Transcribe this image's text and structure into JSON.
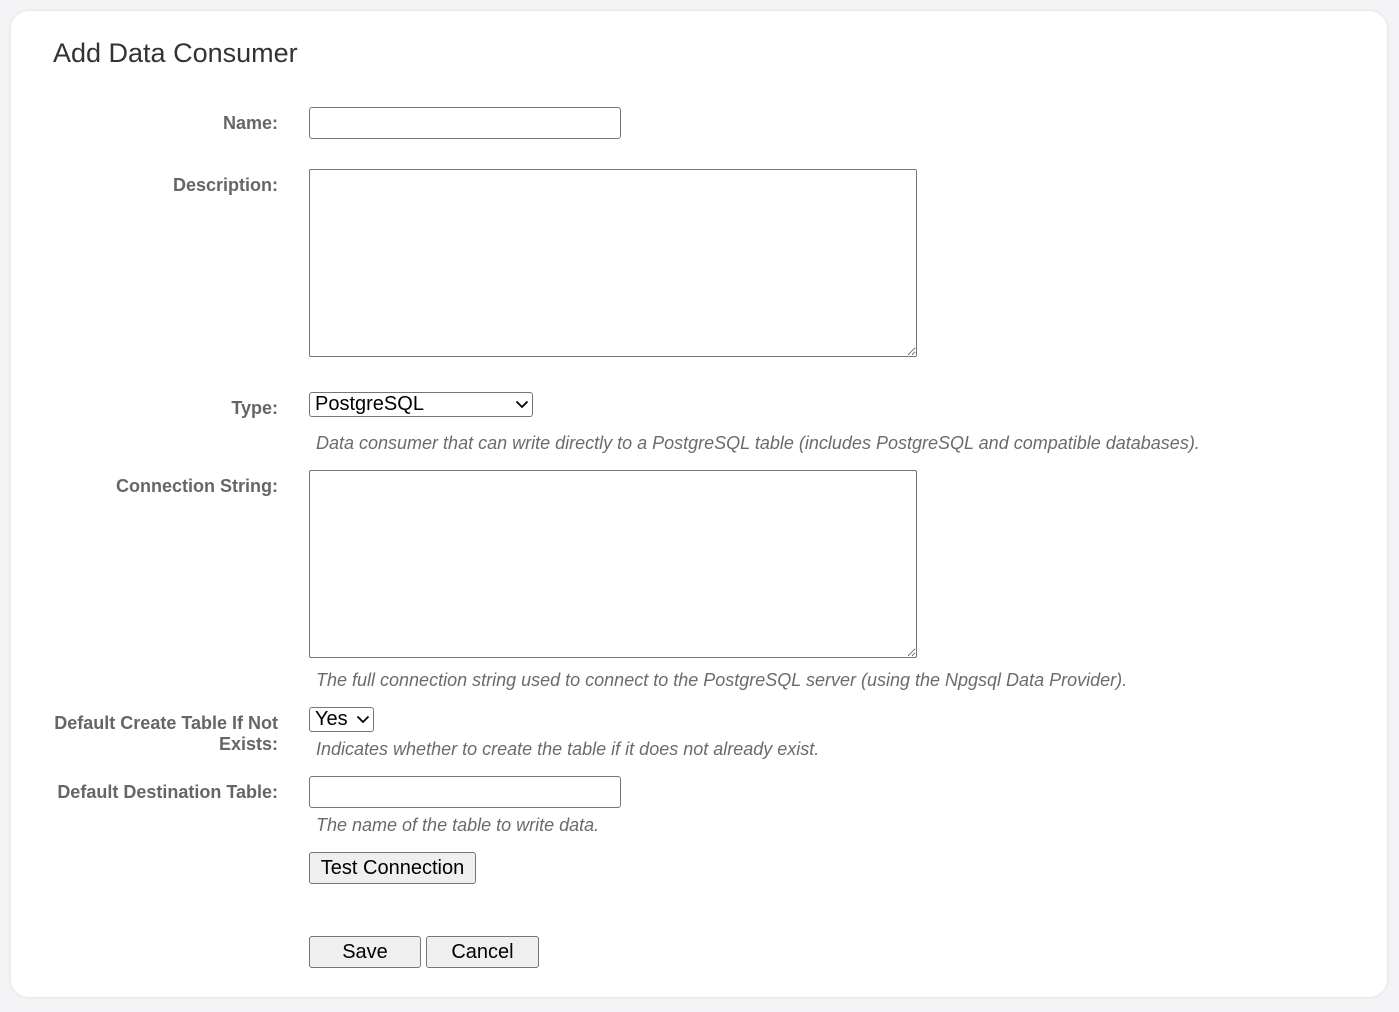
{
  "page": {
    "title": "Add Data Consumer"
  },
  "form": {
    "name": {
      "label": "Name:",
      "value": ""
    },
    "description": {
      "label": "Description:",
      "value": ""
    },
    "type": {
      "label": "Type:",
      "selected": "PostgreSQL",
      "help": "Data consumer that can write directly to a PostgreSQL table (includes PostgreSQL and compatible databases)."
    },
    "connection_string": {
      "label": "Connection String:",
      "value": "",
      "help": "The full connection string used to connect to the PostgreSQL server (using the Npgsql Data Provider)."
    },
    "create_table": {
      "label_line1": "Default Create Table If Not",
      "label_line2": "Exists:",
      "selected": "Yes",
      "help": "Indicates whether to create the table if it does not already exist."
    },
    "destination_table": {
      "label": "Default Destination Table:",
      "value": "",
      "help": "The name of the table to write data."
    }
  },
  "buttons": {
    "test_connection": "Test Connection",
    "save": "Save",
    "cancel": "Cancel"
  },
  "icons": {
    "dropdown": "chevron-down-icon"
  }
}
